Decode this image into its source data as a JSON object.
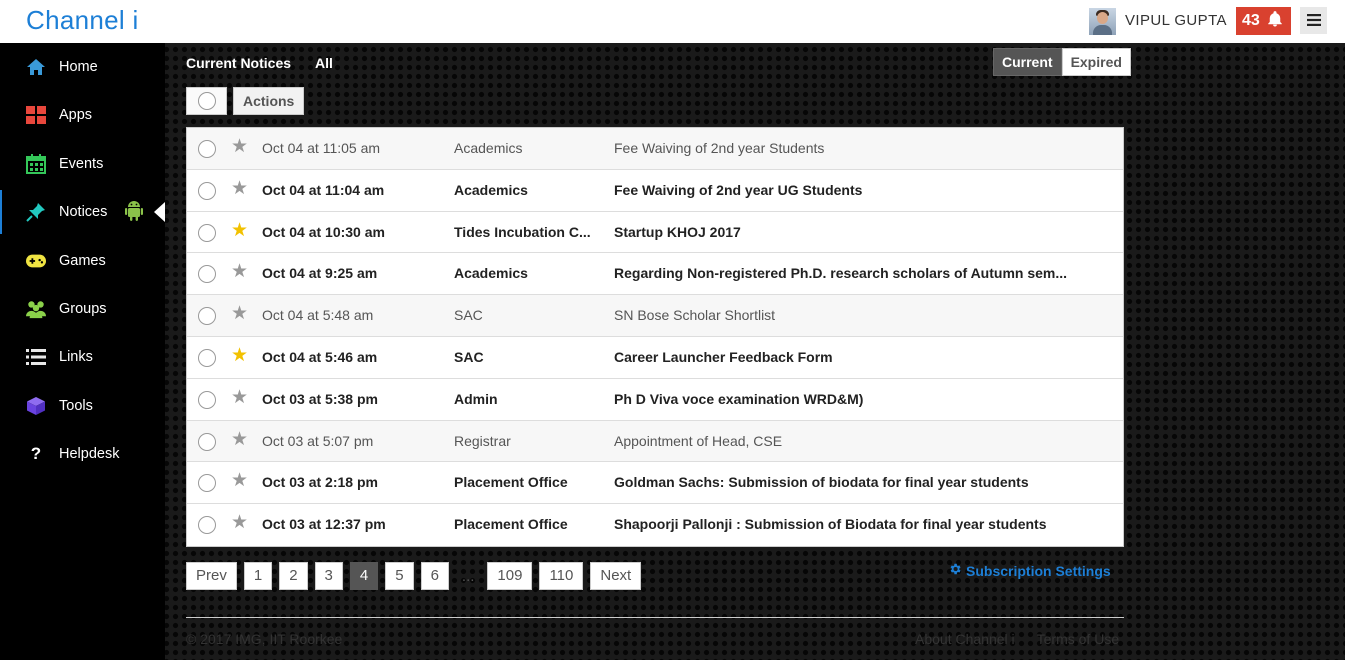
{
  "header": {
    "brand": "Channel i",
    "user_name": "VIPUL GUPTA",
    "notification_count": "43"
  },
  "sidebar": {
    "items": [
      {
        "label": "Home",
        "icon": "home-icon"
      },
      {
        "label": "Apps",
        "icon": "apps-icon"
      },
      {
        "label": "Events",
        "icon": "calendar-icon"
      },
      {
        "label": "Notices",
        "icon": "pin-icon",
        "active": true
      },
      {
        "label": "Games",
        "icon": "gamepad-icon"
      },
      {
        "label": "Groups",
        "icon": "users-icon"
      },
      {
        "label": "Links",
        "icon": "list-icon"
      },
      {
        "label": "Tools",
        "icon": "cube-icon"
      },
      {
        "label": "Helpdesk",
        "icon": "question-icon"
      }
    ]
  },
  "toolbar": {
    "tab_current": "Current Notices",
    "tab_all": "All",
    "toggle_current": "Current",
    "toggle_expired": "Expired",
    "actions_label": "Actions"
  },
  "notices": [
    {
      "date": "Oct 04 at 11:05 am",
      "category": "Academics",
      "title": "Fee Waiving of 2nd year Students",
      "read": true,
      "starred": false
    },
    {
      "date": "Oct 04 at 11:04 am",
      "category": "Academics",
      "title": "Fee Waiving of 2nd year UG Students",
      "read": false,
      "starred": false
    },
    {
      "date": "Oct 04 at 10:30 am",
      "category": "Tides Incubation C...",
      "title": "Startup KHOJ 2017",
      "read": false,
      "starred": true
    },
    {
      "date": "Oct 04 at 9:25 am",
      "category": "Academics",
      "title": "Regarding Non-registered Ph.D. research scholars of Autumn sem...",
      "read": false,
      "starred": false
    },
    {
      "date": "Oct 04 at 5:48 am",
      "category": "SAC",
      "title": "SN Bose Scholar Shortlist",
      "read": true,
      "starred": false
    },
    {
      "date": "Oct 04 at 5:46 am",
      "category": "SAC",
      "title": "Career Launcher Feedback Form",
      "read": false,
      "starred": true
    },
    {
      "date": "Oct 03 at 5:38 pm",
      "category": "Admin",
      "title": "Ph D Viva voce examination WRD&M)",
      "read": false,
      "starred": false
    },
    {
      "date": "Oct 03 at 5:07 pm",
      "category": "Registrar",
      "title": "Appointment of Head, CSE",
      "read": true,
      "starred": false
    },
    {
      "date": "Oct 03 at 2:18 pm",
      "category": "Placement Office",
      "title": "Goldman Sachs: Submission of biodata for final year students",
      "read": false,
      "starred": false
    },
    {
      "date": "Oct 03 at 12:37 pm",
      "category": "Placement Office",
      "title": "Shapoorji Pallonji : Submission of Biodata for final year students",
      "read": false,
      "starred": false
    }
  ],
  "pagination": {
    "prev": "Prev",
    "pages": [
      "1",
      "2",
      "3",
      "4",
      "5",
      "6"
    ],
    "current": "4",
    "ellipsis": "...",
    "last_pages": [
      "109",
      "110"
    ],
    "next": "Next"
  },
  "subscription_label": "Subscription Settings",
  "footer": {
    "copyright": "© 2017 IMG, IIT Roorkee",
    "about": "About Channel i",
    "terms": "Terms of Use"
  }
}
